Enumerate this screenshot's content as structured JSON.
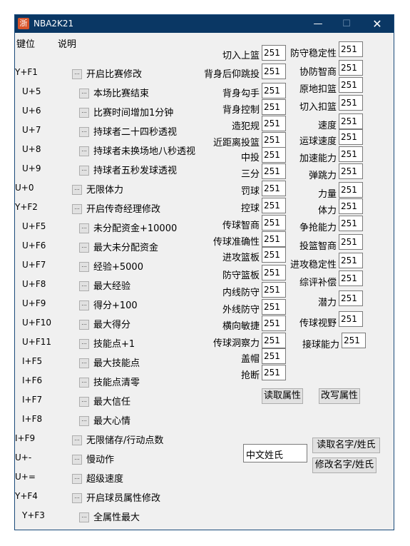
{
  "window": {
    "title": "NBA2K21",
    "icon_char": "浙",
    "min_glyph": "—",
    "max_glyph": "☐",
    "close_glyph": "✕"
  },
  "menu": {
    "hotkeys": "键位",
    "help": "说明"
  },
  "checkbox_glyph": "...",
  "features": [
    {
      "key": "Y+F1",
      "label": "开启比赛修改",
      "indent": false
    },
    {
      "key": "U+5",
      "label": "本场比赛结束",
      "indent": true
    },
    {
      "key": "U+6",
      "label": "比赛时间增加1分钟",
      "indent": true
    },
    {
      "key": "U+7",
      "label": "持球者二十四秒透视",
      "indent": true
    },
    {
      "key": "U+8",
      "label": "持球者未换场地八秒透视",
      "indent": true
    },
    {
      "key": "U+9",
      "label": "持球者五秒发球透视",
      "indent": true
    },
    {
      "key": "U+0",
      "label": "无限体力",
      "indent": false
    },
    {
      "key": "Y+F2",
      "label": "开启传奇经理修改",
      "indent": false
    },
    {
      "key": "U+F5",
      "label": "未分配资金+10000",
      "indent": true
    },
    {
      "key": "U+F6",
      "label": "最大未分配资金",
      "indent": true
    },
    {
      "key": "U+F7",
      "label": "经验+5000",
      "indent": true
    },
    {
      "key": "U+F8",
      "label": "最大经验",
      "indent": true
    },
    {
      "key": "U+F9",
      "label": "得分+100",
      "indent": true
    },
    {
      "key": "U+F10",
      "label": "最大得分",
      "indent": true
    },
    {
      "key": "U+F11",
      "label": "技能点+1",
      "indent": true
    },
    {
      "key": "I+F5",
      "label": "最大技能点",
      "indent": true
    },
    {
      "key": "I+F6",
      "label": "技能点清零",
      "indent": true
    },
    {
      "key": "I+F7",
      "label": "最大信任",
      "indent": true
    },
    {
      "key": "I+F8",
      "label": "最大心情",
      "indent": true
    },
    {
      "key": "I+F9",
      "label": "无限储存/行动点数",
      "indent": false
    },
    {
      "key": "U+-",
      "label": "慢动作",
      "indent": false
    },
    {
      "key": "U+=",
      "label": "超级速度",
      "indent": false
    },
    {
      "key": "Y+F4",
      "label": "开启球员属性修改",
      "indent": false
    },
    {
      "key": "Y+F3",
      "label": "全属性最大",
      "indent": true
    }
  ],
  "attributes_left": [
    {
      "label": "切入上篮",
      "value": "251"
    },
    {
      "label": "背身后仰跳投",
      "value": "251"
    },
    {
      "label": "背身勾手",
      "value": "251"
    },
    {
      "label": "背身控制",
      "value": "251"
    },
    {
      "label": "造犯规",
      "value": "251"
    },
    {
      "label": "近距离投篮",
      "value": "251"
    },
    {
      "label": "中投",
      "value": "251"
    },
    {
      "label": "三分",
      "value": "251"
    },
    {
      "label": "罚球",
      "value": "251"
    },
    {
      "label": "控球",
      "value": "251"
    },
    {
      "label": "传球智商",
      "value": "251"
    },
    {
      "label": "传球准确性",
      "value": "251"
    },
    {
      "label": "进攻篮板",
      "value": "251"
    },
    {
      "label": "防守篮板",
      "value": "251"
    },
    {
      "label": "内线防守",
      "value": "251"
    },
    {
      "label": "外线防守",
      "value": "251"
    },
    {
      "label": "横向敏捷",
      "value": "251"
    },
    {
      "label": "传球洞察力",
      "value": "251"
    },
    {
      "label": "盖帽",
      "value": "251"
    },
    {
      "label": "抢断",
      "value": "251"
    }
  ],
  "attributes_right": [
    {
      "label": "防守稳定性",
      "value": "251"
    },
    {
      "label": "协防智商",
      "value": "251"
    },
    {
      "label": "原地扣篮",
      "value": "251"
    },
    {
      "label": "切入扣篮",
      "value": "251"
    },
    {
      "label": "速度",
      "value": "251"
    },
    {
      "label": "运球速度",
      "value": "251"
    },
    {
      "label": "加速能力",
      "value": "251"
    },
    {
      "label": "弹跳力",
      "value": "251"
    },
    {
      "label": "力量",
      "value": "251"
    },
    {
      "label": "体力",
      "value": "251"
    },
    {
      "label": "争抢能力",
      "value": "251"
    },
    {
      "label": "投篮智商",
      "value": "251"
    },
    {
      "label": "进攻稳定性",
      "value": "251"
    },
    {
      "label": "综评补偿",
      "value": "251"
    },
    {
      "label": "潜力",
      "value": "251"
    },
    {
      "label": "传球视野",
      "value": "251"
    },
    {
      "label": "接球能力",
      "value": "251"
    }
  ],
  "buttons": {
    "read_attr": "读取属性",
    "write_attr": "改写属性",
    "read_name": "读取名字/姓氏",
    "modify_name": "修改名字/姓氏"
  },
  "name_input": {
    "value": "中文姓氏"
  }
}
